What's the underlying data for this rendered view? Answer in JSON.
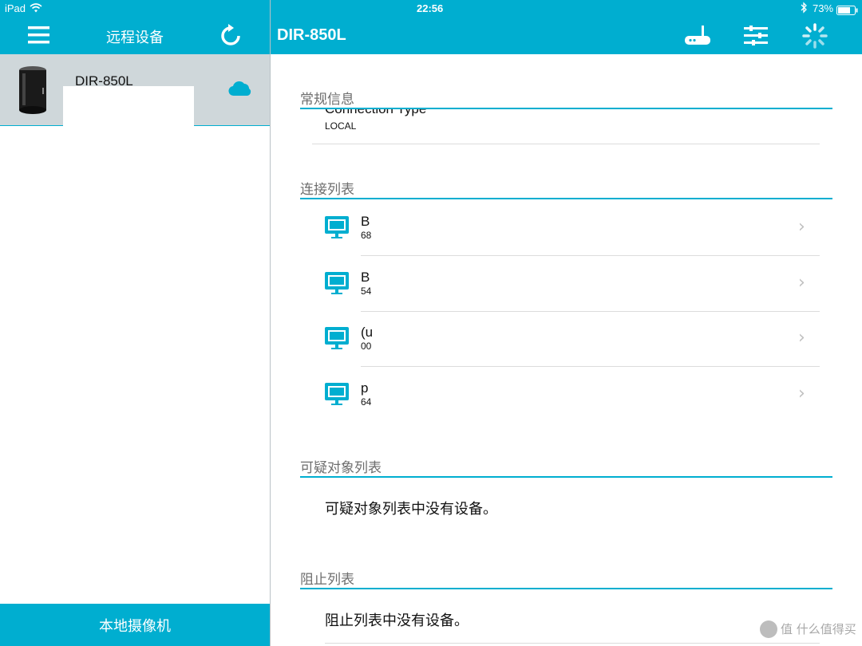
{
  "status": {
    "device": "iPad",
    "time": "22:56",
    "battery": "73%"
  },
  "left": {
    "title": "远程设备",
    "device": {
      "name": "DIR-850L"
    },
    "bottom_button": "本地摄像机"
  },
  "right": {
    "title": "DIR-850L",
    "general": {
      "header": "常规信息",
      "label": "Connection Type",
      "value": "LOCAL"
    },
    "connections": {
      "header": "连接列表",
      "items": [
        {
          "title": "B",
          "sub": "68"
        },
        {
          "title": "B",
          "sub": "54"
        },
        {
          "title": "(u",
          "sub": "00"
        },
        {
          "title": "p",
          "sub": "64"
        }
      ]
    },
    "suspicious": {
      "header": "可疑对象列表",
      "empty": "可疑对象列表中没有设备。"
    },
    "blocked": {
      "header": "阻止列表",
      "empty": "阻止列表中没有设备。"
    }
  },
  "watermark": "值 什么值得买",
  "colors": {
    "accent": "#00aed0",
    "selected_row": "#cfd7da"
  },
  "icons": [
    "wifi-icon",
    "bluetooth-icon",
    "battery-icon",
    "menu-icon",
    "refresh-icon",
    "cloud-icon",
    "router-icon",
    "settings-sliders-icon",
    "loading-spinner-icon",
    "monitor-icon",
    "chevron-right-icon"
  ]
}
